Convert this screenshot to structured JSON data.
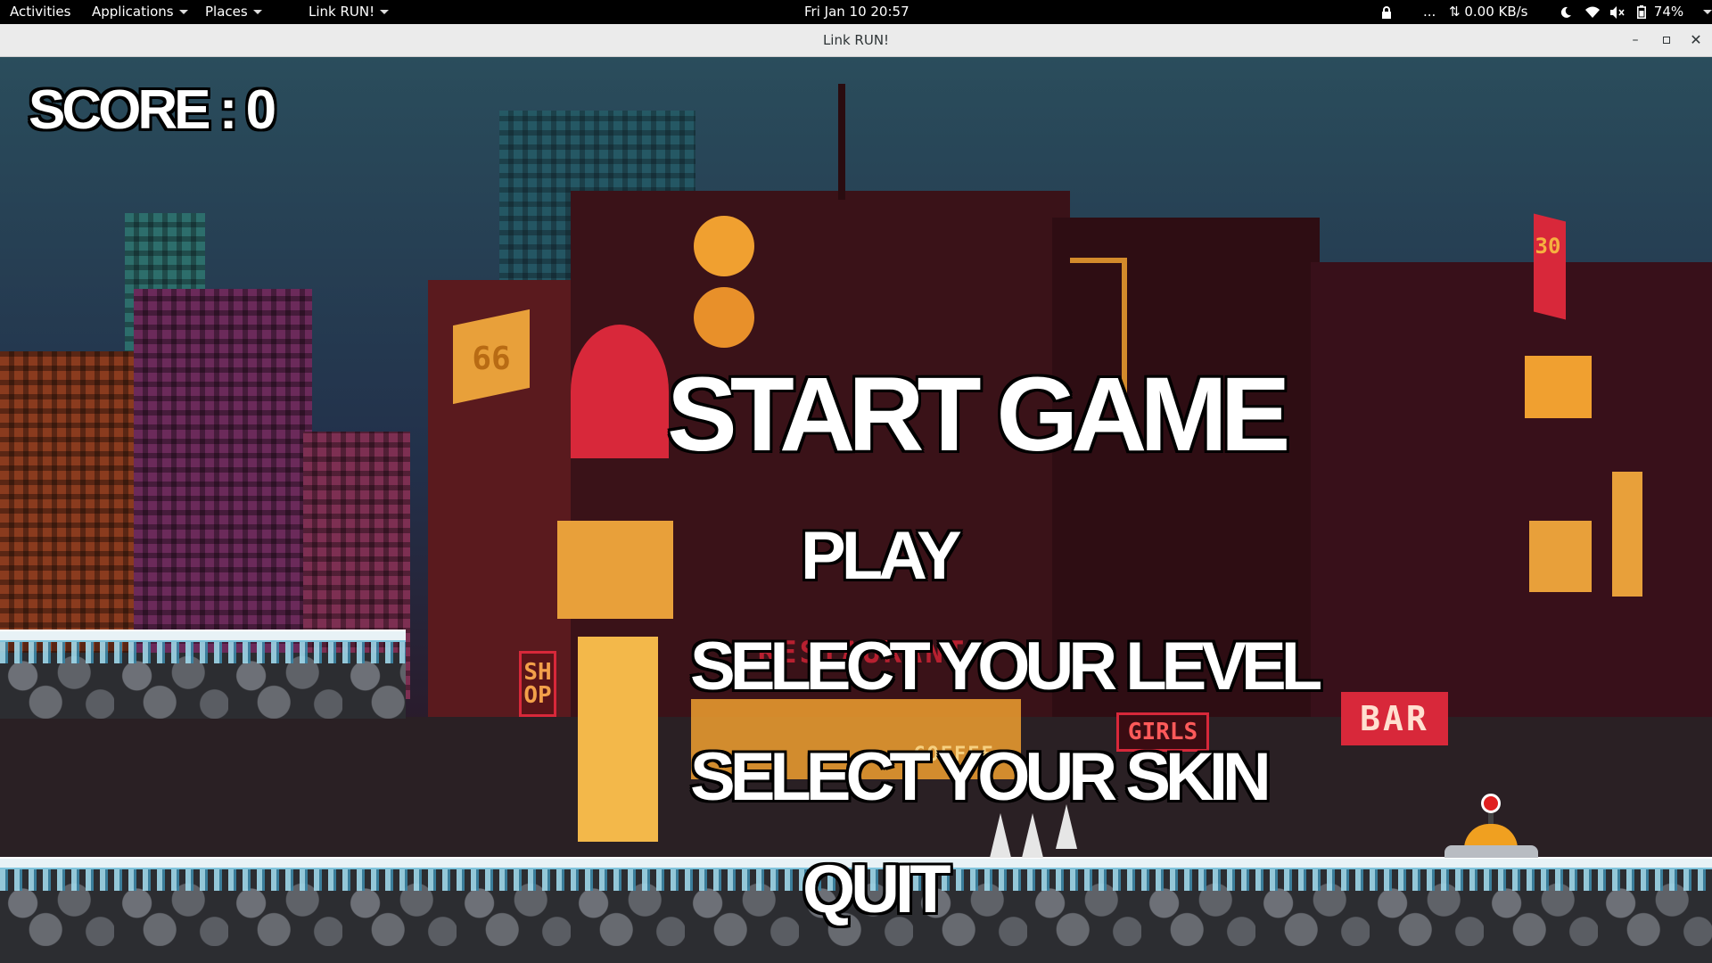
{
  "topbar": {
    "activities": "Activities",
    "applications": "Applications",
    "places": "Places",
    "app_menu": "Link RUN!",
    "clock": "Fri Jan 10  20:57",
    "ellipsis": "...",
    "network_speed": "⇅ 0.00 KB/s",
    "battery": "74%"
  },
  "window": {
    "title": "Link RUN!"
  },
  "game": {
    "score_label": "SCORE : 0",
    "menu_title": "START GAME",
    "menu_items": [
      "PLAY",
      "SELECT YOUR LEVEL",
      "SELECT YOUR SKIN",
      "QUIT"
    ],
    "signs": {
      "shop": "SHOP",
      "restaurant": "RESTAURANT",
      "girls": "GIRLS",
      "bar": "BAR",
      "sign_30": "30",
      "sign_66": "66",
      "coffee": "COFFEE"
    }
  },
  "colors": {
    "sky": "#2a4d5c",
    "neon_orange": "#f0a030",
    "neon_red": "#d8283a",
    "ice": "#e8f2f6",
    "menu_text": "#ffffff"
  }
}
